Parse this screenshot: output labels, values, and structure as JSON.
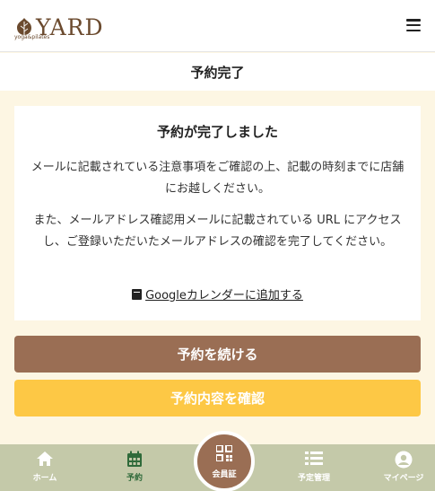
{
  "header": {
    "logo_text": "YARD",
    "logo_sub": "yoga&pilates"
  },
  "page": {
    "title": "予約完了"
  },
  "card": {
    "heading": "予約が完了しました",
    "message1": "メールに記載されている注意事項をご確認の上、記載の時刻までに店舗にお越しください。",
    "message2": "また、メールアドレス確認用メールに記載されている URL にアクセスし、ご登録いただいたメールアドレスの確認を完了してください。",
    "calendar_link": "Googleカレンダーに追加する"
  },
  "buttons": {
    "continue_label": "予約を続ける",
    "confirm_label": "予約内容を確認"
  },
  "tabbar": {
    "home": "ホーム",
    "reserve": "予約",
    "member_card": "会員証",
    "schedule": "予定管理",
    "mypage": "マイページ"
  },
  "colors": {
    "background": "#fdf6e3",
    "brown": "#9a6e54",
    "yellow": "#fdc845",
    "tabbar": "#c4c9a9",
    "active_tab": "#2f6a3a"
  }
}
